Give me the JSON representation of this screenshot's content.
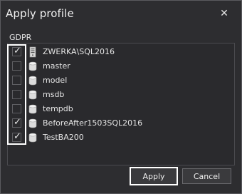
{
  "dialog": {
    "title": "Apply profile",
    "close_label": "✕"
  },
  "group": {
    "label": "GDPR"
  },
  "databases": [
    {
      "name": "ZWERKA\\SQL2016",
      "checked": true,
      "icon": "server-icon"
    },
    {
      "name": "master",
      "checked": false,
      "icon": "database-icon"
    },
    {
      "name": "model",
      "checked": false,
      "icon": "database-icon"
    },
    {
      "name": "msdb",
      "checked": false,
      "icon": "database-icon"
    },
    {
      "name": "tempdb",
      "checked": false,
      "icon": "database-icon"
    },
    {
      "name": "BeforeAfter1503SQL2016",
      "checked": true,
      "icon": "database-icon"
    },
    {
      "name": "TestBA200",
      "checked": true,
      "icon": "database-icon"
    }
  ],
  "buttons": {
    "apply": "Apply",
    "cancel": "Cancel"
  },
  "colors": {
    "background": "#2d2d30",
    "highlight": "#ffffff"
  }
}
